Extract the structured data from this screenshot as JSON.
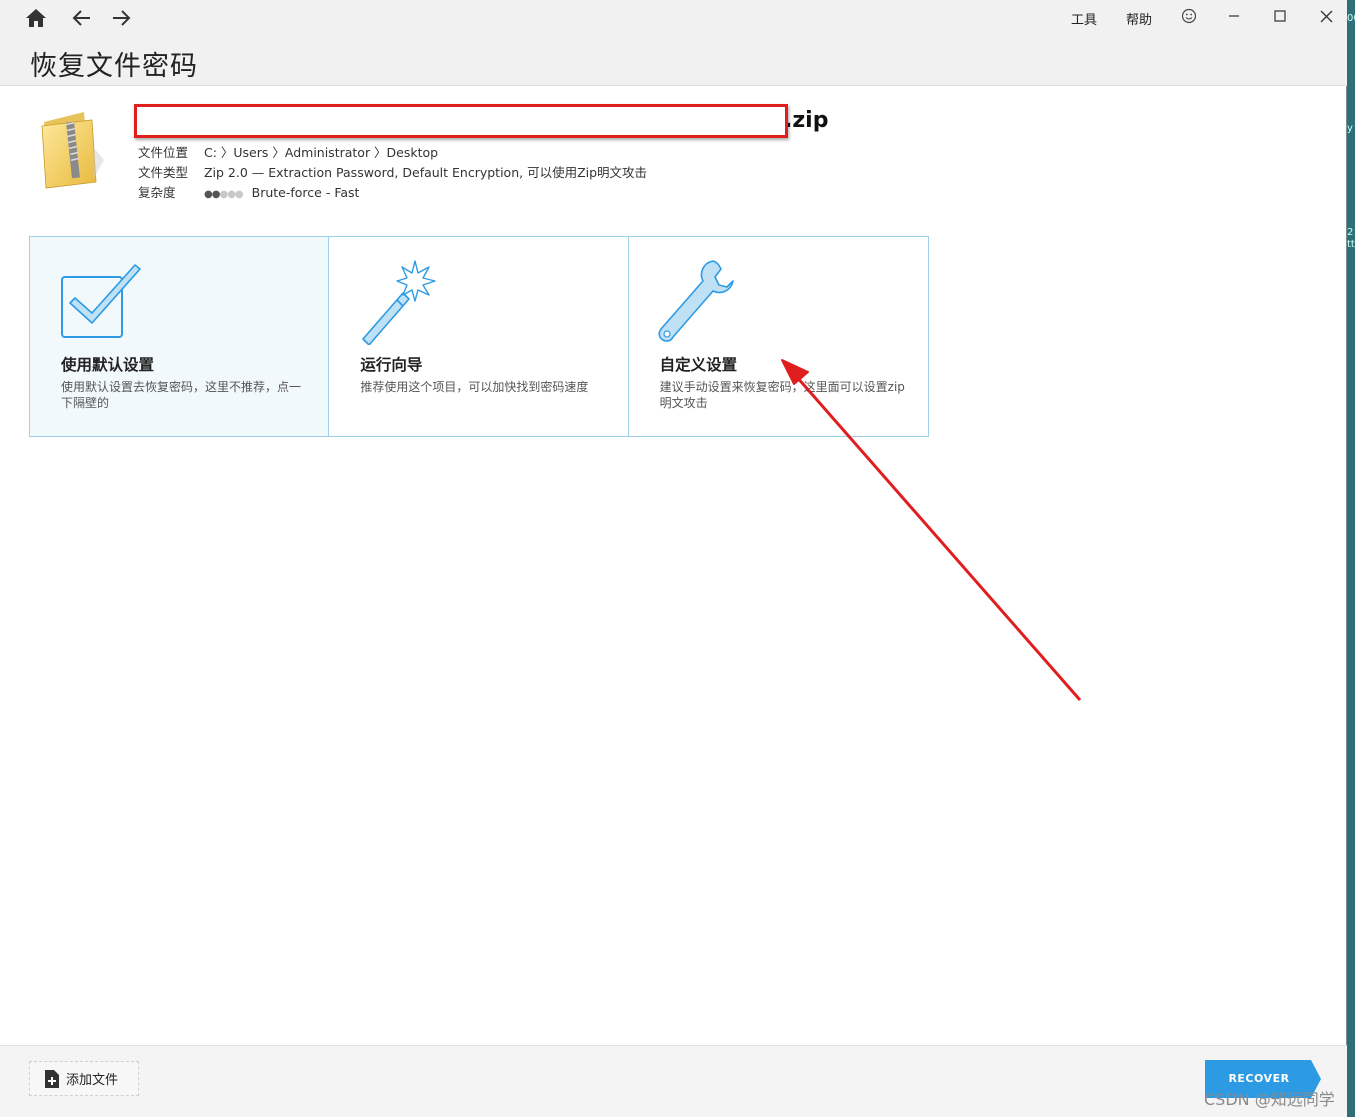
{
  "header": {
    "title": "恢复文件密码",
    "menu_tools": "工具",
    "menu_help": "帮助"
  },
  "file": {
    "name_suffix": ".zip",
    "location_label": "文件位置",
    "location_value": "C: 〉Users 〉Administrator 〉Desktop",
    "type_label": "文件类型",
    "type_value": "Zip 2.0 — Extraction Password, Default Encryption, 可以使用Zip明文攻击",
    "complexity_label": "复杂度",
    "complexity_level": 2,
    "complexity_max": 5,
    "complexity_value": "Brute-force - Fast"
  },
  "options": [
    {
      "title": "使用默认设置",
      "desc": "使用默认设置去恢复密码，这里不推荐，点一下隔壁的",
      "selected": true
    },
    {
      "title": "运行向导",
      "desc": "推荐使用这个项目，可以加快找到密码速度",
      "selected": false
    },
    {
      "title": "自定义设置",
      "desc": "建议手动设置来恢复密码，这里面可以设置zip明文攻击",
      "selected": false
    }
  ],
  "footer": {
    "add_file": "添加文件",
    "recover": "RECOVER"
  },
  "watermark": "CSDN @知远同学",
  "desktop_fragments": [
    "00",
    "y",
    "2",
    "tt"
  ],
  "colors": {
    "accent_blue": "#2d9be4",
    "card_border": "#9ed0ea",
    "annotation_red": "#e01e1e"
  }
}
